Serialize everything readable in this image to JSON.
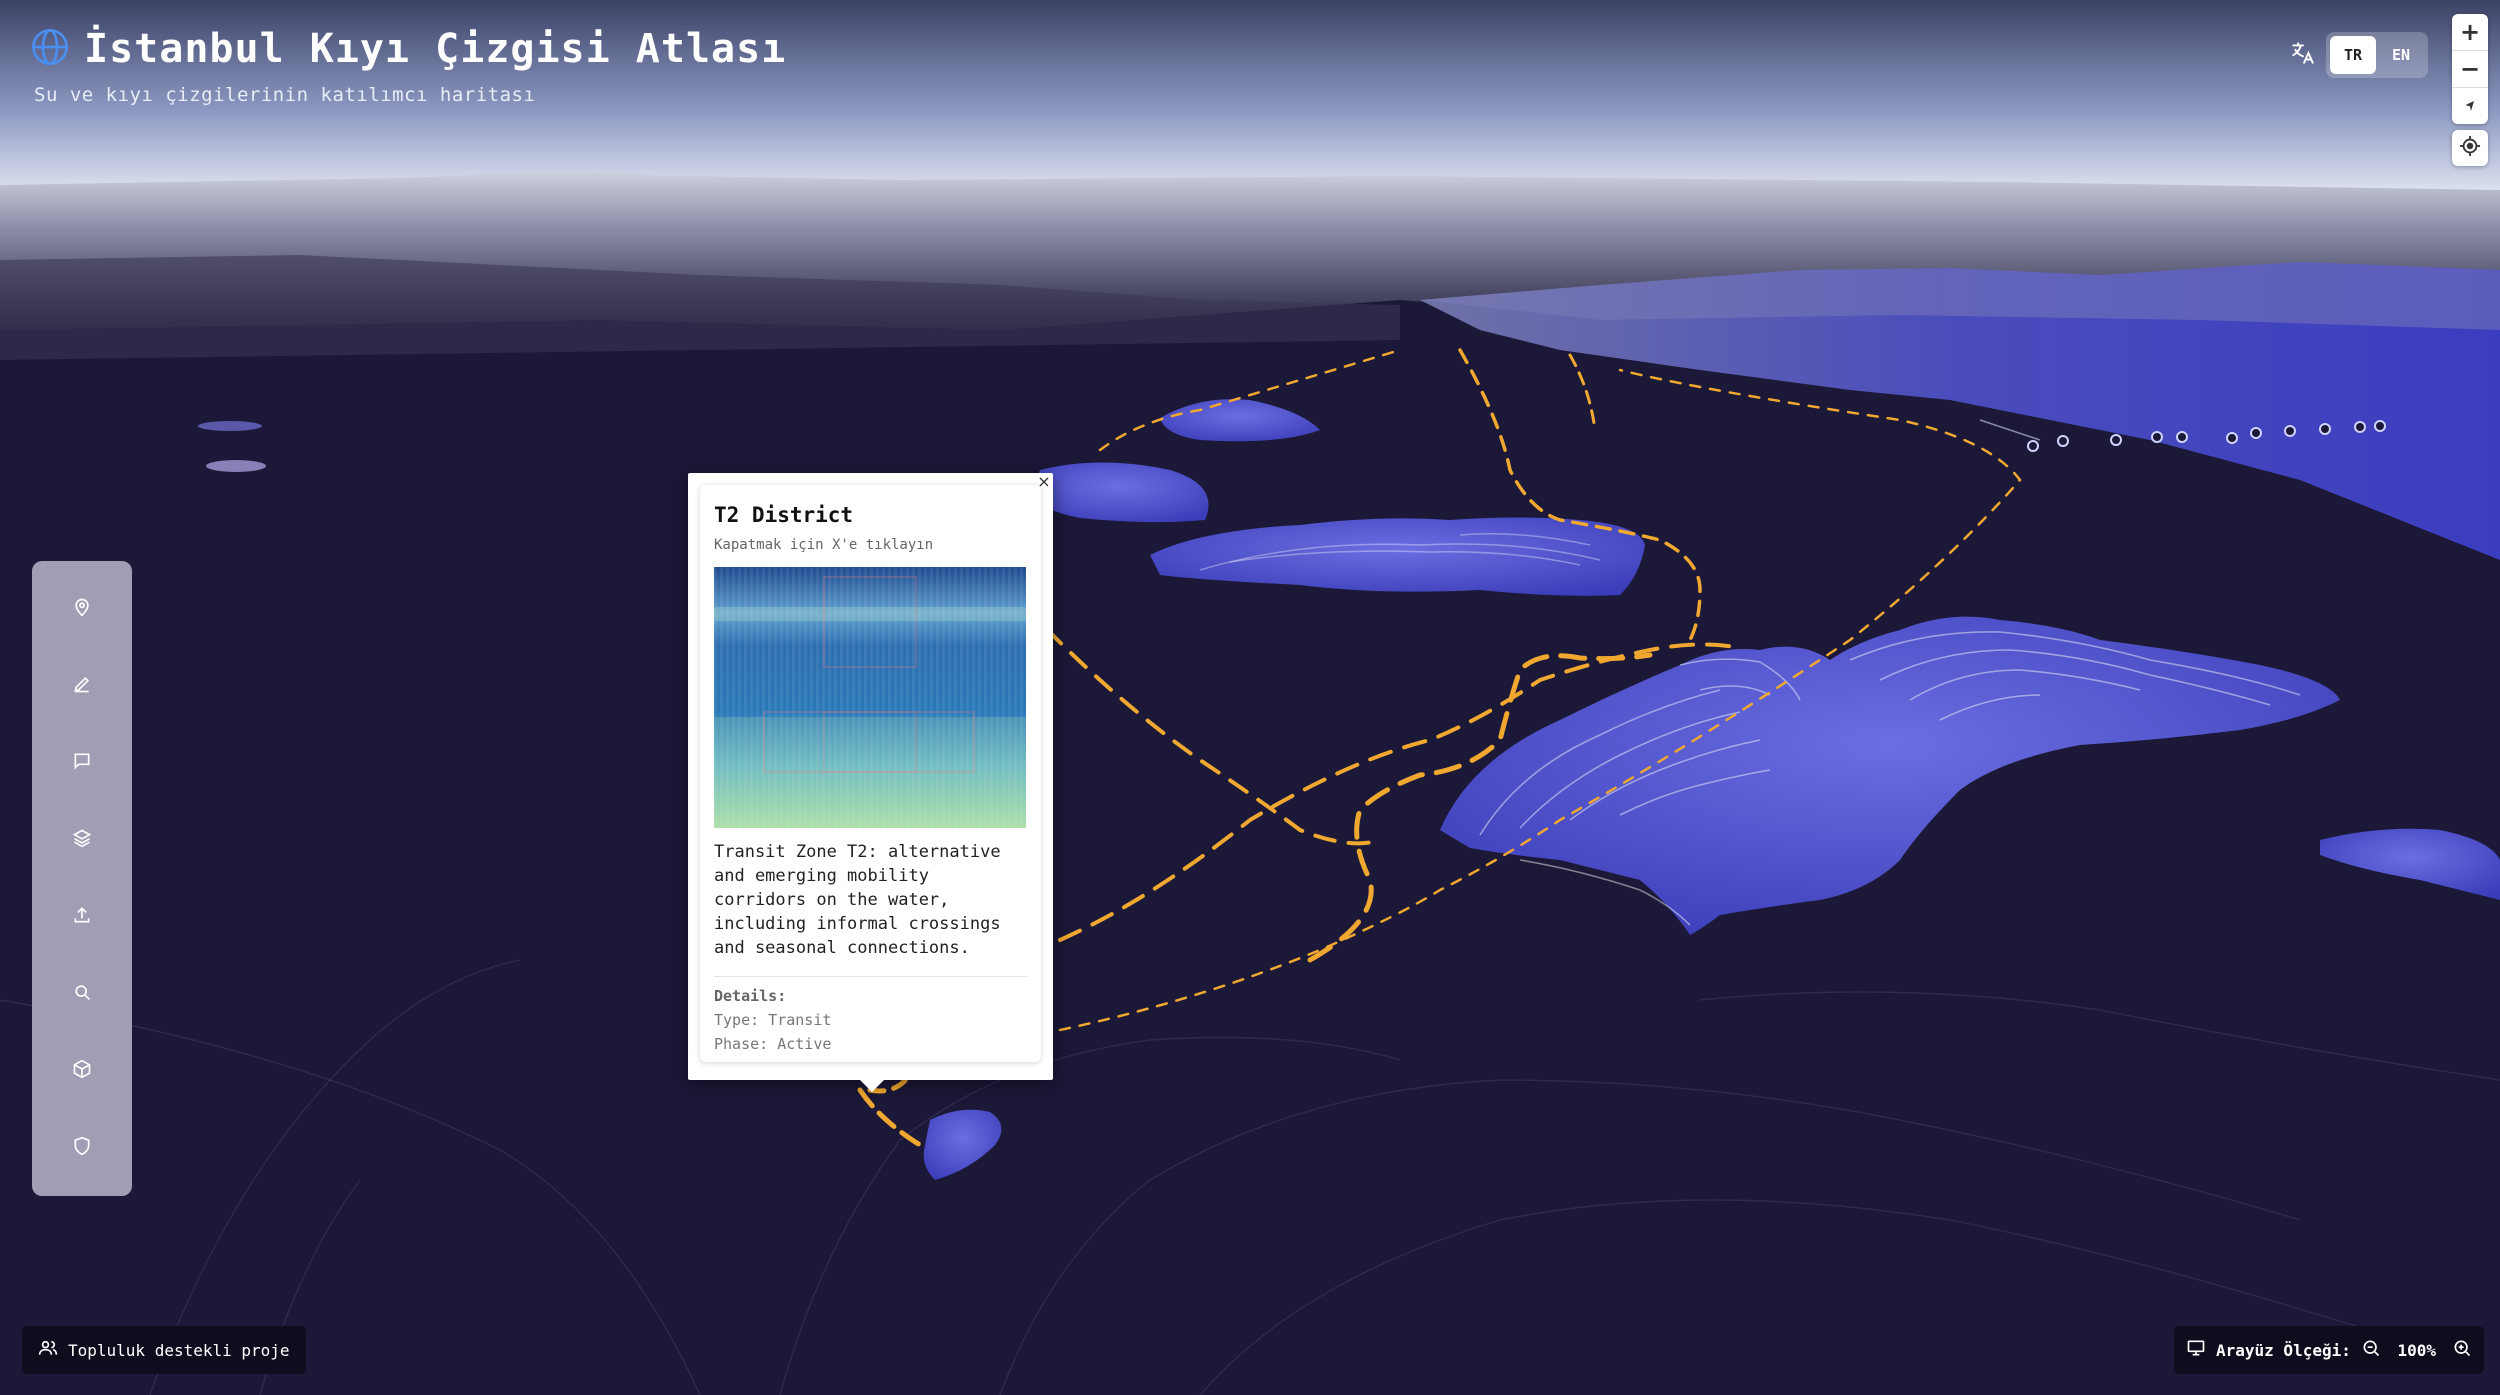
{
  "header": {
    "title": "İstanbul Kıyı Çizgisi Atlası",
    "subtitle": "Su ve kıyı çizgilerinin katılımcı haritası"
  },
  "language": {
    "options": [
      "TR",
      "EN"
    ],
    "active": "TR"
  },
  "map_controls": {
    "zoom_in": "+",
    "zoom_out": "−"
  },
  "toolbar": {
    "tools": [
      "map-pin-icon",
      "pencil-icon",
      "comment-icon",
      "layers-icon",
      "upload-icon",
      "search-icon",
      "cube-icon",
      "shield-icon"
    ]
  },
  "popup": {
    "title": "T2 District",
    "hint": "Kapatmak için X'e tıklayın",
    "close": "×",
    "description": "Transit Zone T2: alternative and emerging mobility corridors on the water, including informal crossings and seasonal connections.",
    "details_heading": "Details:",
    "type_line": "Type: Transit",
    "phase_line": "Phase: Active"
  },
  "footer": {
    "community_label": "Topluluk destekli proje",
    "scale_label": "Arayüz Ölçeği:",
    "scale_value": "100%"
  },
  "colors": {
    "water": "#1b1838",
    "land": "#5052c8",
    "route": "#f0a830",
    "accent": "#4a8ef0"
  }
}
